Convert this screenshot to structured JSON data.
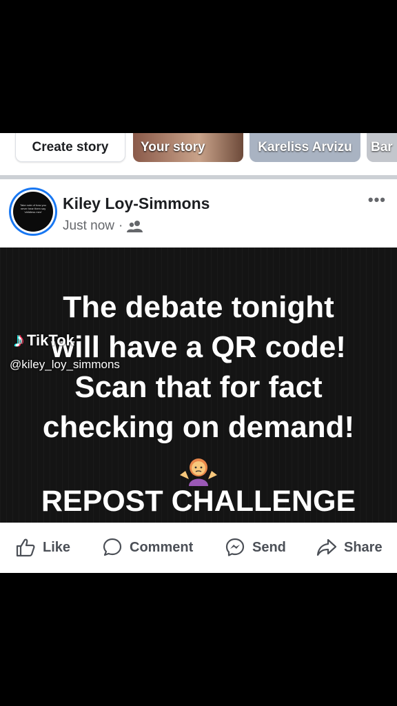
{
  "stories": [
    {
      "label": "Create story"
    },
    {
      "label": "Your story"
    },
    {
      "label": "Kareliss Arvizu"
    },
    {
      "label": "Bar"
    }
  ],
  "post": {
    "author": "Kiley Loy-Simmons",
    "time": "Just now",
    "audience_icon": "friends-icon",
    "avatar_text": "Take note of how you never hear them say 'childless men'",
    "image": {
      "lines": [
        "The debate tonight",
        "will have a QR code!",
        "Scan that for fact",
        "checking on demand!"
      ],
      "emoji": "person-shrugging",
      "repost": "REPOST CHALLENGE",
      "watermark": "TikTok",
      "handle": "@kiley_loy_simmons"
    }
  },
  "actions": {
    "like": "Like",
    "comment": "Comment",
    "send": "Send",
    "share": "Share"
  },
  "colors": {
    "accent": "#1877f2",
    "background": "#000000"
  }
}
